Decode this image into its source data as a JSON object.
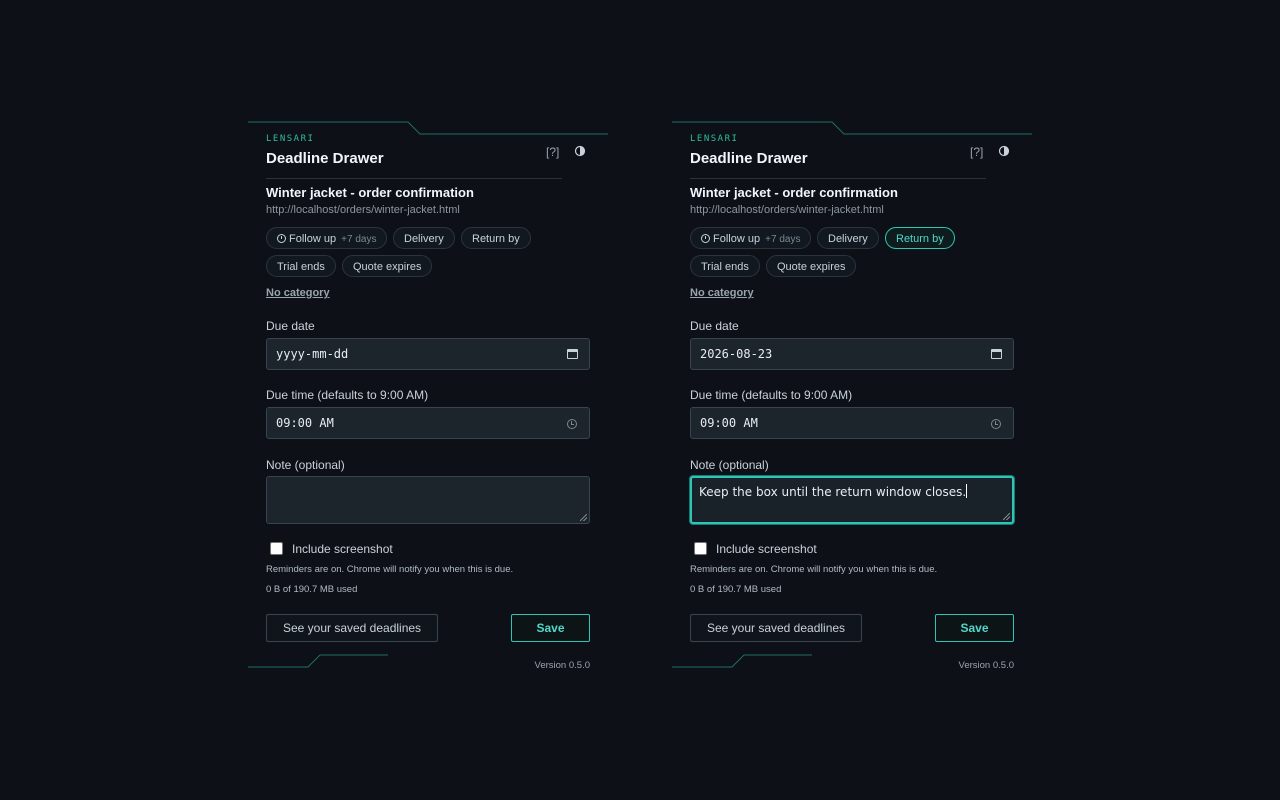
{
  "panels": [
    {
      "brand": "LENSARI",
      "title": "Deadline Drawer",
      "help_label": "[?]",
      "page_title": "Winter jacket - order confirmation",
      "page_url": "http://localhost/orders/winter-jacket.html",
      "presets": [
        {
          "label": "Follow up",
          "sub": "+7 days",
          "active": false
        },
        {
          "label": "Delivery",
          "active": false
        },
        {
          "label": "Return by",
          "active": false
        },
        {
          "label": "Trial ends",
          "active": false
        },
        {
          "label": "Quote expires",
          "active": false
        }
      ],
      "no_category": "No category",
      "due_date_label": "Due date",
      "due_date_value": "yyyy-mm-dd",
      "due_time_label": "Due time (defaults to 9:00 AM)",
      "due_time_value": "09:00 AM",
      "note_label": "Note (optional)",
      "note_value": "",
      "include_screenshot_label": "Include screenshot",
      "include_screenshot_checked": false,
      "reminder_hint": "Reminders are on. Chrome will notify you when this is due.",
      "storage_usage": "0 B of 190.7 MB used",
      "saved_button": "See your saved deadlines",
      "save_button": "Save",
      "version": "Version 0.5.0"
    },
    {
      "brand": "LENSARI",
      "title": "Deadline Drawer",
      "help_label": "[?]",
      "page_title": "Winter jacket - order confirmation",
      "page_url": "http://localhost/orders/winter-jacket.html",
      "presets": [
        {
          "label": "Follow up",
          "sub": "+7 days",
          "active": false
        },
        {
          "label": "Delivery",
          "active": false
        },
        {
          "label": "Return by",
          "active": true
        },
        {
          "label": "Trial ends",
          "active": false
        },
        {
          "label": "Quote expires",
          "active": false
        }
      ],
      "no_category": "No category",
      "due_date_label": "Due date",
      "due_date_value": "2026-08-23",
      "due_time_label": "Due time (defaults to 9:00 AM)",
      "due_time_value": "09:00 AM",
      "note_label": "Note (optional)",
      "note_value": "Keep the box until the return window closes.",
      "include_screenshot_label": "Include screenshot",
      "include_screenshot_checked": false,
      "reminder_hint": "Reminders are on. Chrome will notify you when this is due.",
      "storage_usage": "0 B of 190.7 MB used",
      "saved_button": "See your saved deadlines",
      "save_button": "Save",
      "version": "Version 0.5.0"
    }
  ],
  "colors": {
    "background": "#0d1117",
    "accent": "#2ec4b6",
    "brand": "#2fbf9a"
  },
  "icons": {
    "help": "help-icon",
    "theme": "contrast-icon",
    "follow_up": "clock-icon",
    "date_picker": "calendar-icon",
    "time_picker": "clock-icon"
  }
}
